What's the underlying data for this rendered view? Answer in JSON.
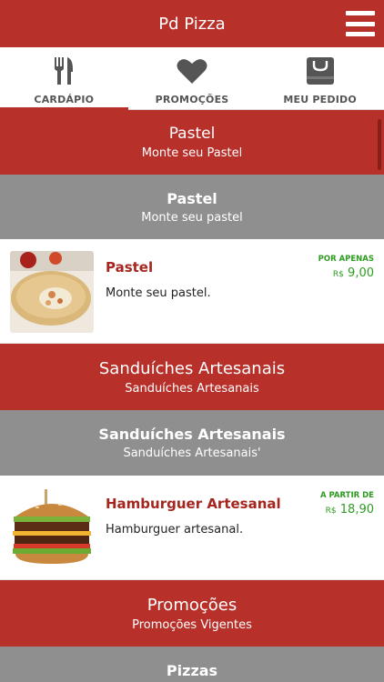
{
  "header": {
    "title": "Pd Pizza",
    "menu_icon": "hamburger-menu-icon"
  },
  "tabs": [
    {
      "label": "CARDÁPIO",
      "icon": "fork-knife-icon",
      "active": true
    },
    {
      "label": "PROMOÇÕES",
      "icon": "heart-icon",
      "active": false
    },
    {
      "label": "MEU PEDIDO",
      "icon": "shopping-bag-icon",
      "active": false
    }
  ],
  "list": {
    "cat1": {
      "title": "Pastel",
      "subtitle": "Monte seu Pastel"
    },
    "sub1": {
      "title": "Pastel",
      "subtitle": "Monte seu pastel"
    },
    "prod1": {
      "name": "Pastel",
      "description": "Monte seu pastel.",
      "price_prefix": "POR APENAS",
      "currency": "R$",
      "price": "9,00"
    },
    "cat2": {
      "title": "Sanduíches Artesanais",
      "subtitle": "Sanduíches Artesanais"
    },
    "sub2": {
      "title": "Sanduíches Artesanais",
      "subtitle": "Sanduíches Artesanais'"
    },
    "prod2": {
      "name": "Hamburguer Artesanal",
      "description": "Hamburguer artesanal.",
      "price_prefix": "A PARTIR DE",
      "currency": "R$",
      "price": "18,90"
    },
    "cat3": {
      "title": "Promoções",
      "subtitle": "Promoções Vigentes"
    },
    "sub3": {
      "title": "Pizzas"
    }
  },
  "colors": {
    "brand_red": "#b7302a",
    "gray": "#8f8f8f",
    "price_green": "#2e9b21",
    "product_name": "#a5261f"
  }
}
